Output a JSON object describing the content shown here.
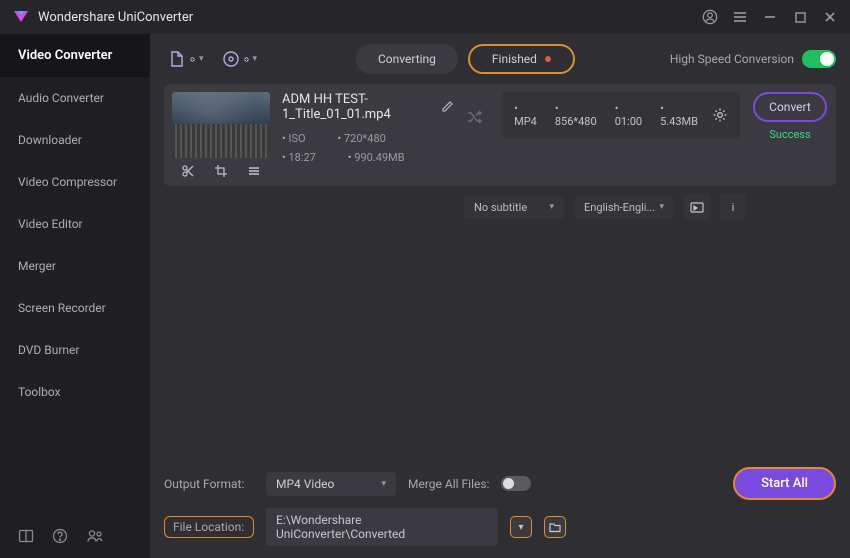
{
  "app": {
    "title": "Wondershare UniConverter"
  },
  "sidebar": {
    "items": [
      {
        "label": "Video Converter"
      },
      {
        "label": "Audio Converter"
      },
      {
        "label": "Downloader"
      },
      {
        "label": "Video Compressor"
      },
      {
        "label": "Video Editor"
      },
      {
        "label": "Merger"
      },
      {
        "label": "Screen Recorder"
      },
      {
        "label": "DVD Burner"
      },
      {
        "label": "Toolbox"
      }
    ]
  },
  "toolbar": {
    "tabs": {
      "converting": "Converting",
      "finished": "Finished"
    },
    "hsc_label": "High Speed Conversion"
  },
  "file": {
    "name": "ADM HH TEST-1_Title_01_01.mp4",
    "src": {
      "codec": "ISO",
      "res": "720*480",
      "dur": "18:27",
      "size": "990.49MB"
    },
    "dst": {
      "fmt": "MP4",
      "res": "856*480",
      "dur": "01:00",
      "size": "5.43MB"
    },
    "status": "Success",
    "convert_label": "Convert",
    "subtitle": "No subtitle",
    "audio": "English-Engli..."
  },
  "bottom": {
    "out_format_label": "Output Format:",
    "out_format_value": "MP4 Video",
    "merge_label": "Merge All Files:",
    "file_loc_label": "File Location:",
    "file_loc_value": "E:\\Wondershare UniConverter\\Converted",
    "start_all": "Start All"
  },
  "info_char": "i"
}
